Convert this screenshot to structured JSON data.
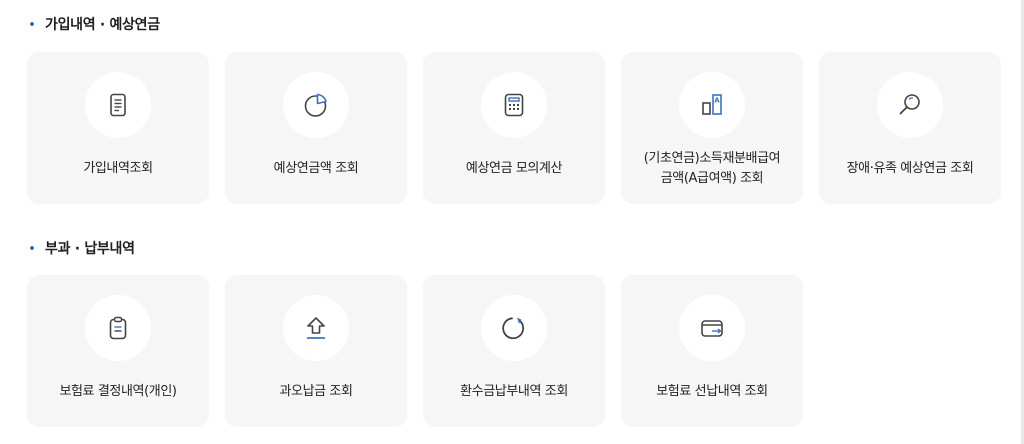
{
  "sections": [
    {
      "title": "가입내역 · 예상연금",
      "cards": [
        {
          "label": "가입내역조회",
          "icon": "document-icon"
        },
        {
          "label": "예상연금액 조회",
          "icon": "pie-chart-icon"
        },
        {
          "label": "예상연금 모의계산",
          "icon": "calculator-icon"
        },
        {
          "label": "(기초연금)소득재분배급여\n금액(A급여액) 조회",
          "icon": "a-value-icon"
        },
        {
          "label": "장애·유족 예상연금 조회",
          "icon": "search-icon"
        }
      ]
    },
    {
      "title": "부과 · 납부내역",
      "cards": [
        {
          "label": "보험료 결정내역(개인)",
          "icon": "clipboard-icon"
        },
        {
          "label": "과오납금 조회",
          "icon": "upload-arrow-icon"
        },
        {
          "label": "환수금납부내역 조회",
          "icon": "refresh-icon"
        },
        {
          "label": "보험료 선납내역 조회",
          "icon": "wallet-icon"
        }
      ]
    }
  ],
  "colors": {
    "accent": "#3f6fc2",
    "icon_stroke": "#444444",
    "card_bg": "#f6f6f7"
  }
}
